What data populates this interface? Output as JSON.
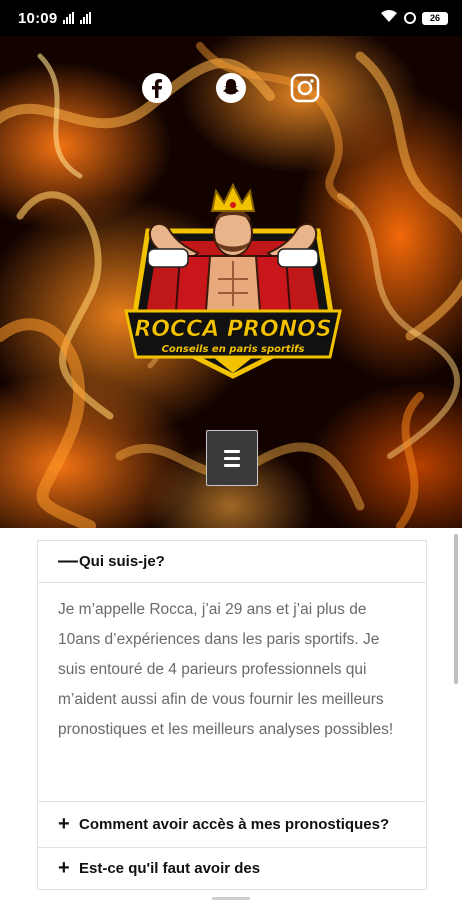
{
  "status_bar": {
    "time": "10:09",
    "battery": "26",
    "icons": [
      "signal-icon",
      "wifi-icon",
      "alarm-icon",
      "battery-icon"
    ]
  },
  "hero": {
    "social_icons": [
      "facebook-icon",
      "snapchat-icon",
      "instagram-icon"
    ],
    "logo": {
      "title": "ROCCA PRONOS",
      "tagline": "Conseils en paris sportifs"
    },
    "menu_icon": "hamburger-icon"
  },
  "faq": {
    "items": [
      {
        "sign": "—",
        "question": "Qui suis-je?",
        "answer": "Je m’appelle Rocca, j’ai 29 ans et j’ai plus de 10ans d’expériences dans les paris sportifs. Je suis entouré de 4 parieurs professionnels qui m’aident aussi afin de vous fournir les meilleurs pronostiques et les meilleurs analyses possibles!"
      },
      {
        "sign": "+",
        "question": "Comment avoir accès à mes pronostiques?"
      },
      {
        "sign": "+",
        "question": "Est-ce qu'il faut avoir des"
      }
    ]
  },
  "colors": {
    "fire": "#ff7a10",
    "logo_red": "#d41a1a",
    "logo_gold": "#f2c200",
    "menu_bg": "#3a3a3a"
  }
}
